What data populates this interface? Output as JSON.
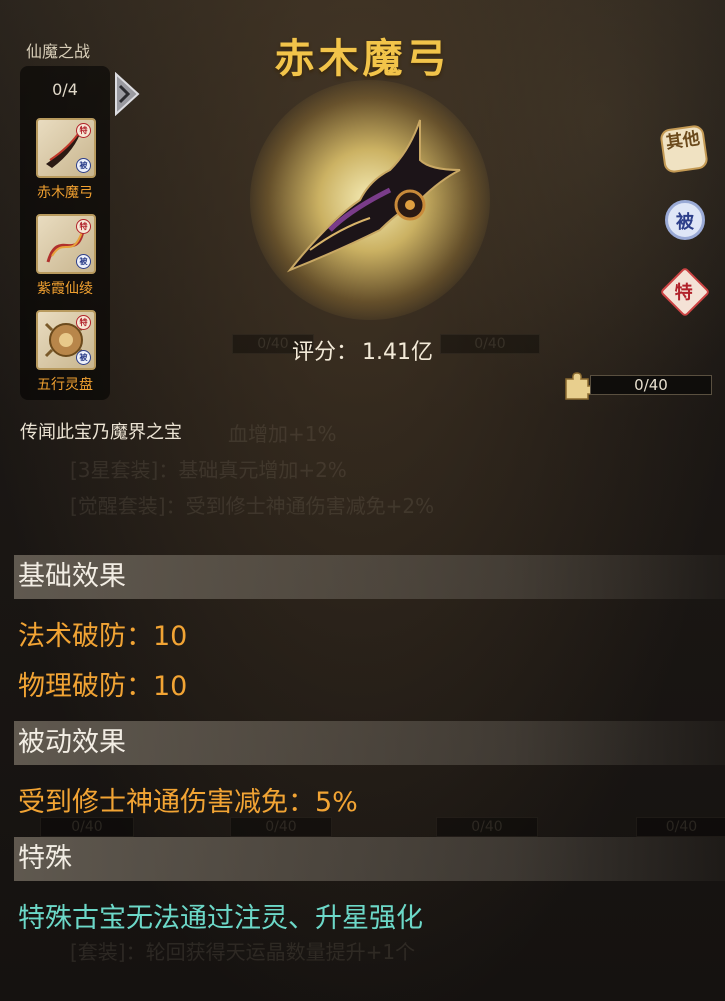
{
  "sidebar": {
    "title": "仙魔之战",
    "count": "0/4",
    "items": [
      {
        "label": "赤木魔弓",
        "tag_top": "特",
        "tag_bottom": "被"
      },
      {
        "label": "紫霞仙绫",
        "tag_top": "特",
        "tag_bottom": "被"
      },
      {
        "label": "五行灵盘",
        "tag_top": "特",
        "tag_bottom": "被"
      }
    ]
  },
  "item": {
    "name": "赤木魔弓",
    "score_label": "评分：",
    "score_value": "1.41亿",
    "description": "传闻此宝乃魔界之宝"
  },
  "badges": {
    "other": "其他",
    "passive": "被",
    "special": "特"
  },
  "puzzle": {
    "progress_text": "0/40",
    "icon": "puzzle-piece-icon"
  },
  "sections": {
    "basic": {
      "title": "基础效果",
      "lines": [
        "法术破防：10",
        "物理破防：10"
      ]
    },
    "passive": {
      "title": "被动效果",
      "lines": [
        "受到修士神通伤害减免：5%"
      ]
    },
    "special": {
      "title": "特殊",
      "lines": [
        "特殊古宝无法通过注灵、升星强化"
      ]
    }
  },
  "background_text": {
    "line1": "血增加+1%",
    "line2": "[3星套装]：基础真元增加+2%",
    "line3": "[觉醒套装]：受到修士神通伤害减免+2%",
    "line4": "[套装]：轮回获得天运晶数量提升+1个",
    "bars": [
      "0/40",
      "0/40",
      "0/40",
      "0/40",
      "0/40",
      "0/40"
    ]
  },
  "colors": {
    "title_gold": "#f2c44a",
    "effect_orange": "#f2a434",
    "special_cyan": "#6cd8c8",
    "sidebar_label": "#f0a030"
  }
}
